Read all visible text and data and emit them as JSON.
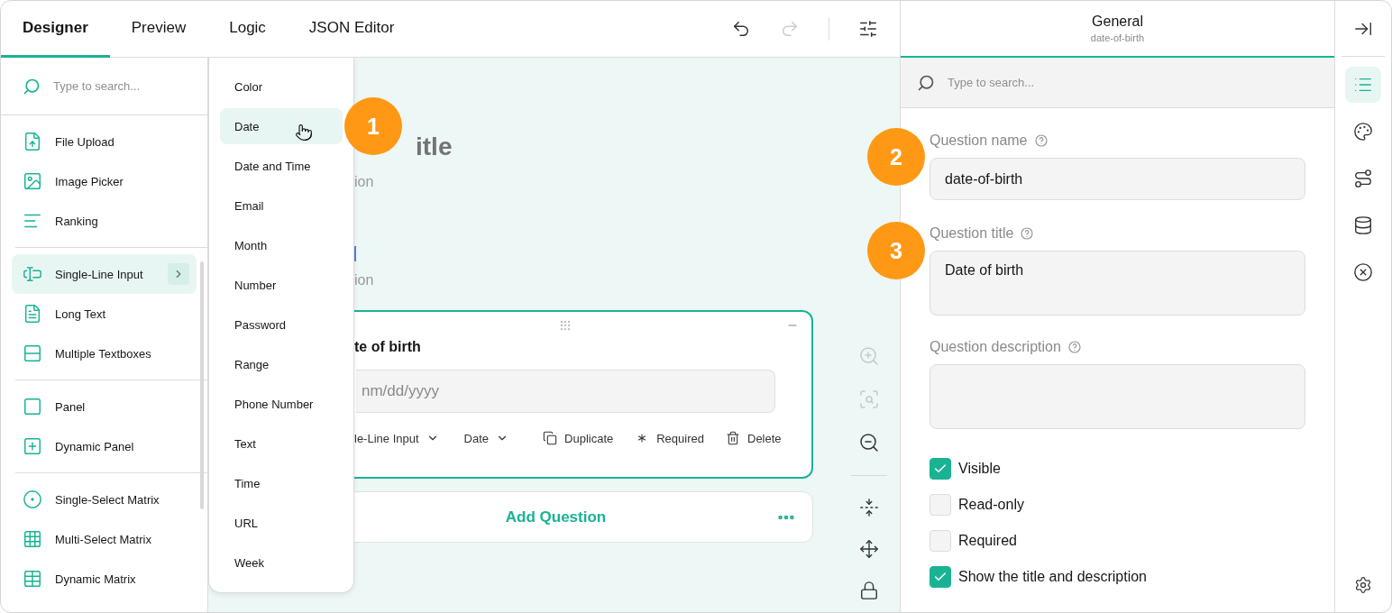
{
  "header": {
    "tabs": [
      {
        "label": "Designer",
        "selected": true
      },
      {
        "label": "Preview",
        "selected": false
      },
      {
        "label": "Logic",
        "selected": false
      },
      {
        "label": "JSON Editor",
        "selected": false
      }
    ],
    "undo": {
      "disabled": false
    },
    "redo": {
      "disabled": true
    }
  },
  "toolbox": {
    "search": {
      "placeholder": "Type to search..."
    },
    "groups": [
      {
        "items": [
          {
            "label": "File Upload",
            "selected": false
          },
          {
            "label": "Image Picker",
            "selected": false
          },
          {
            "label": "Ranking",
            "selected": false
          }
        ]
      },
      {
        "items": [
          {
            "label": "Single-Line Input",
            "selected": true
          },
          {
            "label": "Long Text",
            "selected": false
          },
          {
            "label": "Multiple Textboxes",
            "selected": false
          }
        ]
      },
      {
        "items": [
          {
            "label": "Panel",
            "selected": false
          },
          {
            "label": "Dynamic Panel",
            "selected": false
          }
        ]
      },
      {
        "items": [
          {
            "label": "Single-Select Matrix",
            "selected": false
          },
          {
            "label": "Multi-Select Matrix",
            "selected": false
          },
          {
            "label": "Dynamic Matrix",
            "selected": false
          }
        ]
      }
    ]
  },
  "submenu": {
    "items": [
      {
        "label": "Color",
        "selected": false
      },
      {
        "label": "Date",
        "selected": true
      },
      {
        "label": "Date and Time",
        "selected": false
      },
      {
        "label": "Email",
        "selected": false
      },
      {
        "label": "Month",
        "selected": false
      },
      {
        "label": "Number",
        "selected": false
      },
      {
        "label": "Password",
        "selected": false
      },
      {
        "label": "Range",
        "selected": false
      },
      {
        "label": "Phone Number",
        "selected": false
      },
      {
        "label": "Text",
        "selected": false
      },
      {
        "label": "Time",
        "selected": false
      },
      {
        "label": "URL",
        "selected": false
      },
      {
        "label": "Week",
        "selected": false
      }
    ]
  },
  "canvas": {
    "survey_title": "itle",
    "survey_description": "ion",
    "page_description": "ion",
    "question": {
      "title": "te of birth",
      "placeholder": "nm/dd/yyyy",
      "type_select": "le-Line Input",
      "input_type_select": "Date",
      "actions": [
        "Duplicate",
        "Required",
        "Delete"
      ]
    },
    "add_question": "Add Question",
    "zoom_tools": [
      {
        "disabled": true
      },
      {
        "disabled": true
      },
      {
        "disabled": false
      }
    ]
  },
  "properties": {
    "title": "General",
    "subtitle": "date-of-birth",
    "search": {
      "placeholder": "Type to search..."
    },
    "fields": [
      {
        "label": "Question name",
        "value": "date-of-birth",
        "kind": "input"
      },
      {
        "label": "Question title",
        "value": "Date of birth",
        "kind": "textarea"
      },
      {
        "label": "Question description",
        "kind": "textarea"
      }
    ],
    "checkboxes": [
      {
        "label": "Visible",
        "checked": true
      },
      {
        "label": "Read-only",
        "checked": false
      },
      {
        "label": "Required",
        "checked": false
      },
      {
        "label": "Show the title and description",
        "checked": true
      }
    ]
  },
  "side_tabs": [
    {
      "selected": true
    },
    {
      "selected": false
    },
    {
      "selected": false
    },
    {
      "selected": false
    },
    {
      "selected": false
    }
  ],
  "badges": [
    "1",
    "2",
    "3"
  ]
}
